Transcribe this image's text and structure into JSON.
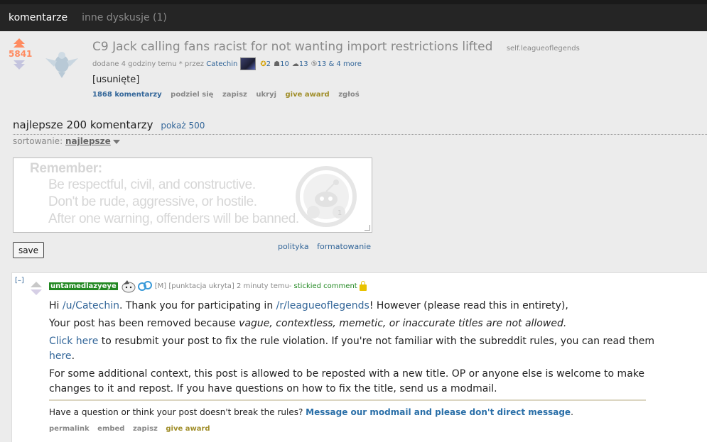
{
  "tabs": {
    "active": "komentarze",
    "other": "inne dyskusje (1)"
  },
  "post": {
    "score": "5841",
    "title": "C9 Jack calling fans racist for not wanting import restrictions lifted",
    "domain": "self.leagueoflegends",
    "tagline_prefix": "dodane 4 godziny temu * przez",
    "author": "Catechin",
    "awards": {
      "a1": "2",
      "a2": "10",
      "a3": "13",
      "a4": "13 & 4 more"
    },
    "body": "[usunięte]",
    "buttons": {
      "comments": "1868 komentarzy",
      "share": "podziel się",
      "save": "zapisz",
      "hide": "ukryj",
      "award": "give award",
      "report": "zgłoś"
    }
  },
  "comments_header": {
    "title": "najlepsze 200 komentarzy",
    "show_more": "pokaż 500",
    "sort_label": "sortowanie:",
    "sort_value": "najlepsze"
  },
  "reminder": {
    "title": "Remember:",
    "lines": [
      "Be respectful, civil, and constructive.",
      "Don't be rude, aggressive, or hostile.",
      "After one warning, offenders will be banned."
    ]
  },
  "form": {
    "save": "save",
    "policy": "polityka",
    "formatting": "formatowanie"
  },
  "comment": {
    "collapse": "[–]",
    "author": "untamedlazyeye",
    "flair_m": "[M]",
    "score_hidden": "[punktacja ukryta]",
    "time": "2 minuty temu",
    "sep": " - ",
    "stickied": "stickied comment",
    "p1_a": "Hi ",
    "p1_user": "/u/Catechin",
    "p1_b": ". Thank you for participating in ",
    "p1_sub": "/r/leagueoflegends",
    "p1_c": "! However (please read this in entirety),",
    "p2_a": "Your post has been removed because ",
    "p2_em": "vague, contextless, memetic, or inaccurate titles are not allowed.",
    "p3_link": "Click here",
    "p3_a": " to resubmit your post to fix the rule violation. If you're not familiar with the subreddit rules, you can read them ",
    "p3_link2": "here",
    "p3_b": ".",
    "p4": "For some additional context, this post is allowed to be reposted with a new title. OP or anyone else is welcome to make changes to it and repost. If you have questions on how to fix the title, send us a modmail.",
    "p5_a": "Have a question or think your post doesn't break the rules? ",
    "p5_link": "Message our modmail and please don't direct message",
    "p5_b": ".",
    "buttons": {
      "permalink": "permalink",
      "embed": "embed",
      "save": "zapisz",
      "award": "give award"
    }
  }
}
